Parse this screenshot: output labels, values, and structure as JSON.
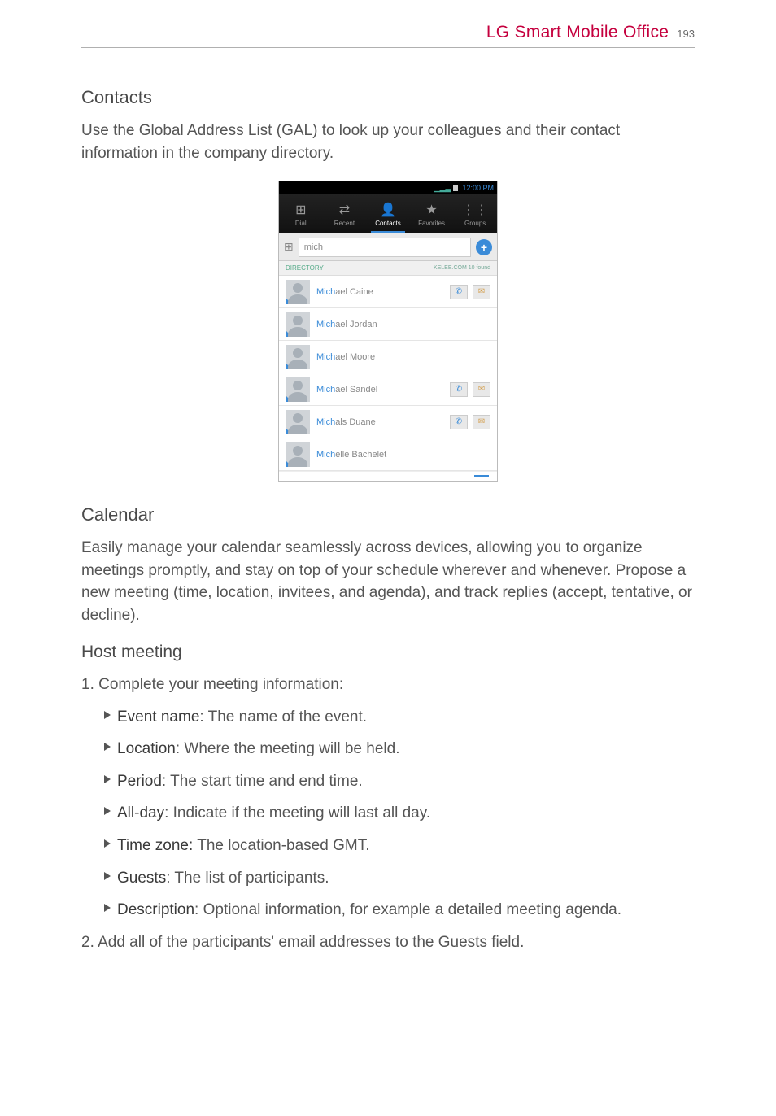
{
  "header": {
    "title": "LG Smart Mobile Office",
    "page_number": "193"
  },
  "contacts_section": {
    "heading": "Contacts",
    "body": "Use the Global Address List (GAL) to look up your colleagues and their contact information in the company directory."
  },
  "phone": {
    "status_time": "12:00 PM",
    "tabs": [
      {
        "icon": "⊞",
        "label": "Dial"
      },
      {
        "icon": "⇄",
        "label": "Recent"
      },
      {
        "icon": "👤",
        "label": "Contacts"
      },
      {
        "icon": "★",
        "label": "Favorites"
      },
      {
        "icon": "⋮⋮",
        "label": "Groups"
      }
    ],
    "search_value": "mich",
    "directory_label": "DIRECTORY",
    "directory_right": "KELEE.COM  10 found",
    "contacts": [
      {
        "prefix": "Mich",
        "rest": "ael Caine",
        "call": true,
        "msg": true
      },
      {
        "prefix": "Mich",
        "rest": "ael Jordan",
        "call": false,
        "msg": false
      },
      {
        "prefix": "Mich",
        "rest": "ael Moore",
        "call": false,
        "msg": false
      },
      {
        "prefix": "Mich",
        "rest": "ael Sandel",
        "call": true,
        "msg": true
      },
      {
        "prefix": "Mich",
        "rest": "als Duane",
        "call": true,
        "msg": true
      },
      {
        "prefix": "Mich",
        "rest": "elle Bachelet",
        "call": false,
        "msg": false
      }
    ]
  },
  "calendar_section": {
    "heading": "Calendar",
    "body": "Easily manage your calendar seamlessly across devices, allowing you to organize meetings promptly, and stay on top of your schedule wherever and whenever. Propose a new meeting (time, location, invitees, and agenda), and track replies (accept, tentative, or decline)."
  },
  "host_meeting": {
    "heading": "Host meeting",
    "step1_prefix": "1.  ",
    "step1_text": "Complete your meeting information:",
    "bullets": [
      {
        "term": "Event name",
        "rest": ": The name of the event."
      },
      {
        "term": "Location",
        "rest": ": Where the meeting will be held."
      },
      {
        "term": "Period",
        "rest": ": The start time and end time."
      },
      {
        "term": "All-day",
        "rest": ": Indicate if the meeting will last all day."
      },
      {
        "term": "Time zone:",
        "rest": " The location-based GMT."
      },
      {
        "term": "Guests",
        "rest": ": The list of participants."
      },
      {
        "term": "Description",
        "rest": ": Optional information, for example a detailed meeting agenda."
      }
    ],
    "step2_prefix": "2.  ",
    "step2_text": "Add all of the participants' email addresses to the Guests field."
  }
}
